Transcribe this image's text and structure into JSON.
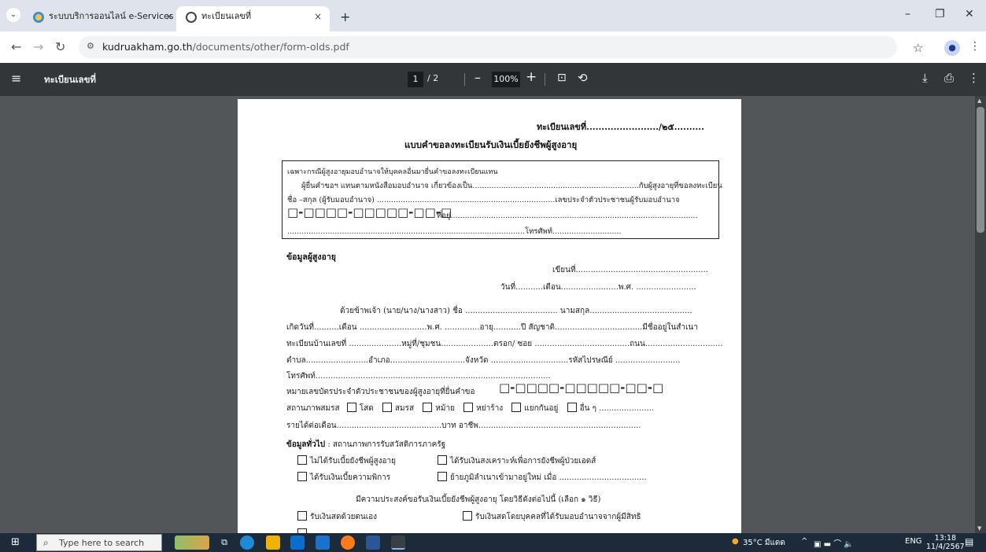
{
  "tabs": [
    {
      "title": "ระบบบริการออนไลน์ e-Services",
      "close": "×",
      "active": false
    },
    {
      "title": "ทะเบียนเลขที่",
      "close": "×",
      "active": true
    }
  ],
  "new_tab_label": "+",
  "window_controls": {
    "minimize": "–",
    "maximize": "❐",
    "close": "✕"
  },
  "toolbar": {
    "back": "←",
    "forward": "→",
    "reload": "↻",
    "url_host": "kudruakham.go.th",
    "url_path": "/documents/other/form-olds.pdf",
    "bookmark": "☆",
    "profile": "●",
    "menu": "⋮"
  },
  "pdf_toolbar": {
    "menu": "≡",
    "title": "ทะเบียนเลขที่",
    "current_page": "1",
    "total_pages": "/ 2",
    "zoom_out": "–",
    "zoom": "100%",
    "zoom_in": "+",
    "fit": "⊡",
    "rotate": "⟲",
    "download": "⤓",
    "print": "⎙",
    "more": "⋮"
  },
  "document": {
    "reg_no": "ทะเบียนเลขที่......................../๒๕..........",
    "form_title": "แบบคำขอลงทะเบียนรับเงินเบี้ยยังชีพผู้สูงอายุ",
    "proxy": {
      "line1": "เฉพาะกรณีผู้สูงอายุมอบอำนาจให้บุคคลอื่นมายื่นคำขอลงทะเบียนแทน",
      "line2": "ผู้ยื่นคำขอฯ แทนตามหนังสือมอบอำนาจ เกี่ยวข้องเป็น......................................................................กับผู้สูงอายุที่ขอลงทะเบียน",
      "line3": "ชื่อ –สกุล (ผู้รับมอบอำนาจ) ...........................................................................เลขประจำตัวประชาชนผู้รับมอบอำนาจ",
      "id_boxes": "□-□□□□-□□□□□-□□-□",
      "address": "ที่อยู่........................................................................................................",
      "phone": "....................................................................................................โทรศัพท์............................."
    },
    "elder_heading": "ข้อมูลผู้สูงอายุ",
    "written_at": "เขียนที่.....................................................",
    "date_line": "วันที่...........เดือน.......................พ.ศ. ........................",
    "name_line": "ด้วยข้าพเจ้า (นาย/นาง/นางสาว) ชื่อ ..................................... นามสกุล.........................................",
    "birth_line": "เกิดวันที่..........เดือน ...........................พ.ศ. ..............อายุ...........ปี สัญชาติ...................................มีชื่ออยู่ในสำเนา",
    "house_line": "ทะเบียนบ้านเลขที่ .....................หมู่ที่/ชุมชน.....................ตรอก/ ซอย ......................................ถนน...............................",
    "district_line": "ตำบล.........................อำเภอ..............................จังหวัด ...............................รหัสไปรษณีย์ ..........................",
    "phone_line": "โทรศัพท์..............................................................................................",
    "id_line": "หมายเลขบัตรประจำตัวประชาชนของผู้สูงอายุที่ยื่นคำขอ",
    "id_boxes": "□-□□□□-□□□□□-□□-□",
    "marital_label": "สถานภาพสมรส",
    "marital_options": [
      "โสด",
      "สมรส",
      "หม้าย",
      "หย่าร้าง",
      "แยกกันอยู่",
      "อื่น ๆ ......................"
    ],
    "income_line": "รายได้ต่อเดือน..........................................บาท อาชีพ.................................................................",
    "general_heading": "ข้อมูลทั่วไป",
    "general_sub": " : สถานภาพการรับสวัสดิการภาครัฐ",
    "welfare": [
      "ไม่ได้รับเบี้ยยังชีพผู้สูงอายุ",
      "ได้รับเงินสงเคราะห์เพื่อการยังชีพผู้ป่วยเอดส์",
      "ได้รับเงินเบี้ยความพิการ",
      "ย้ายภูมิลำเนาเข้ามาอยู่ใหม่ เมื่อ ..................................."
    ],
    "intent_line": "มีความประสงค์ขอรับเงินเบี้ยยังชีพผู้สูงอายุ โดยวิธีดังต่อไปนี้ (เลือก ๑ วิธี)",
    "methods": [
      "รับเงินสดด้วยตนเอง",
      "รับเงินสดโดยบุคคลที่ได้รับมอบอำนาจจากผู้มีสิทธิ"
    ]
  },
  "taskbar": {
    "search_placeholder": "Type here to search",
    "weather": "35°C มีแดด",
    "tray_icons": "^",
    "lang": "ENG",
    "time": "13:18",
    "date": "11/4/2567"
  },
  "colors": {
    "pdf_toolbar": "#323639",
    "viewer_bg": "#525659",
    "tab_strip": "#dfe3eb",
    "taskbar": "#1c2a3a"
  }
}
